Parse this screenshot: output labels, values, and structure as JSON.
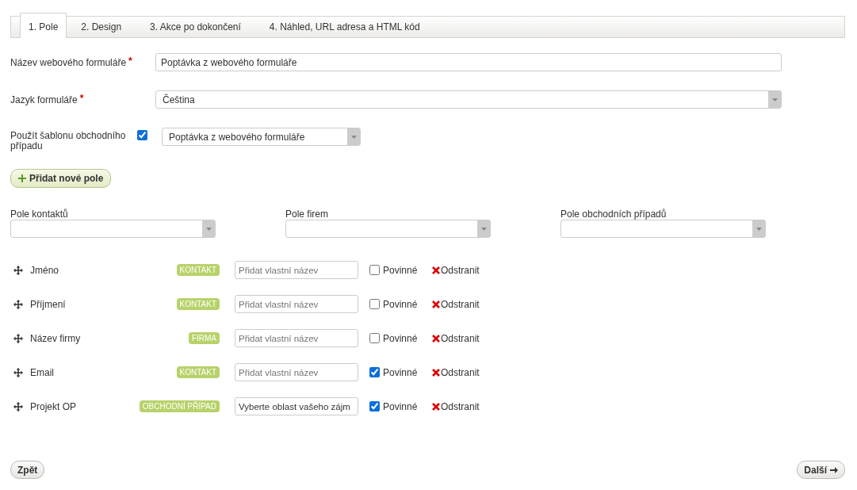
{
  "tabs": [
    {
      "label": "1. Pole",
      "selected": true
    },
    {
      "label": "2. Design",
      "selected": false
    },
    {
      "label": "3. Akce po dokončení",
      "selected": false
    },
    {
      "label": "4. Náhled, URL adresa a HTML kód",
      "selected": false
    }
  ],
  "form_name": {
    "label": "Název webového formuláře",
    "required_mark": "*",
    "value": "Poptávka z webového formuláře"
  },
  "language": {
    "label": "Jazyk formuláře",
    "required_mark": "*",
    "value": "Čeština"
  },
  "template": {
    "label": "Použít šablonu obchodního případu",
    "checked": true,
    "value": "Poptávka z webového formuláře"
  },
  "add_field_button": "Přidat nové pole",
  "field_pickers": [
    {
      "label": "Pole kontaktů"
    },
    {
      "label": "Pole firem"
    },
    {
      "label": "Pole obchodních případů"
    }
  ],
  "fields": [
    {
      "name": "Jméno",
      "badge": "KONTAKT",
      "placeholder": "Přidat vlastní název",
      "required_label": "Povinné",
      "required": false,
      "remove": "Odstranit"
    },
    {
      "name": "Příjmení",
      "badge": "KONTAKT",
      "placeholder": "Přidat vlastní název",
      "required_label": "Povinné",
      "required": false,
      "remove": "Odstranit"
    },
    {
      "name": "Název firmy",
      "badge": "FIRMA",
      "placeholder": "Přidat vlastní název",
      "required_label": "Povinné",
      "required": false,
      "remove": "Odstranit"
    },
    {
      "name": "Email",
      "badge": "KONTAKT",
      "placeholder": "Přidat vlastní název",
      "required_label": "Povinné",
      "required": true,
      "remove": "Odstranit"
    },
    {
      "name": "Projekt OP",
      "badge": "OBCHODNÍ PŘÍPAD",
      "value": "Vyberte oblast vašeho zájm",
      "required_label": "Povinné",
      "required": true,
      "remove": "Odstranit"
    }
  ],
  "back_button": "Zpět",
  "next_button": "Další"
}
